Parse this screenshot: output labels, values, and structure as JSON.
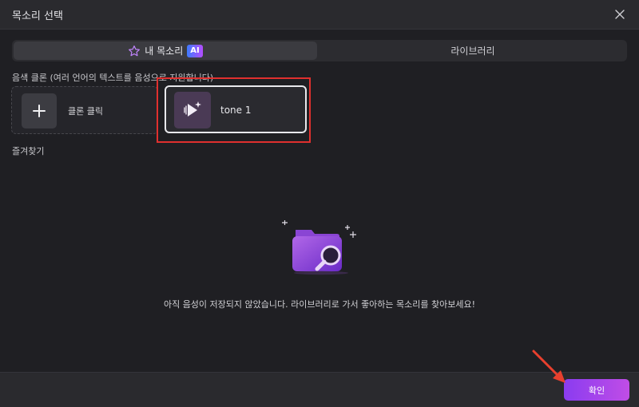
{
  "dialog": {
    "title": "목소리 선택",
    "close_icon": "close-icon"
  },
  "tabs": [
    {
      "label": "내 목소리",
      "badge": "AI",
      "icon": "star-outline-icon",
      "active": true
    },
    {
      "label": "라이브러리",
      "active": false
    }
  ],
  "clone_section": {
    "label": "음색 클론 (여러 언어의 텍스트를 음성으로 지원합니다)",
    "clone_button_label": "클론 클릭",
    "voices": [
      {
        "name": "tone 1",
        "icon": "voice-play-sparkle-icon"
      }
    ]
  },
  "favorites": {
    "label": "즐겨찾기",
    "empty_message": "아직 음성이 저장되지 않았습니다. 라이브러리로 가서 좋아하는 목소리를 찾아보세요!",
    "empty_icon": "empty-folder-search-icon"
  },
  "footer": {
    "confirm_label": "확인"
  },
  "colors": {
    "background": "#1f1f23",
    "accent_gradient_start": "#8a3cf0",
    "accent_gradient_end": "#c04de6",
    "highlight_red": "#e0302e"
  }
}
